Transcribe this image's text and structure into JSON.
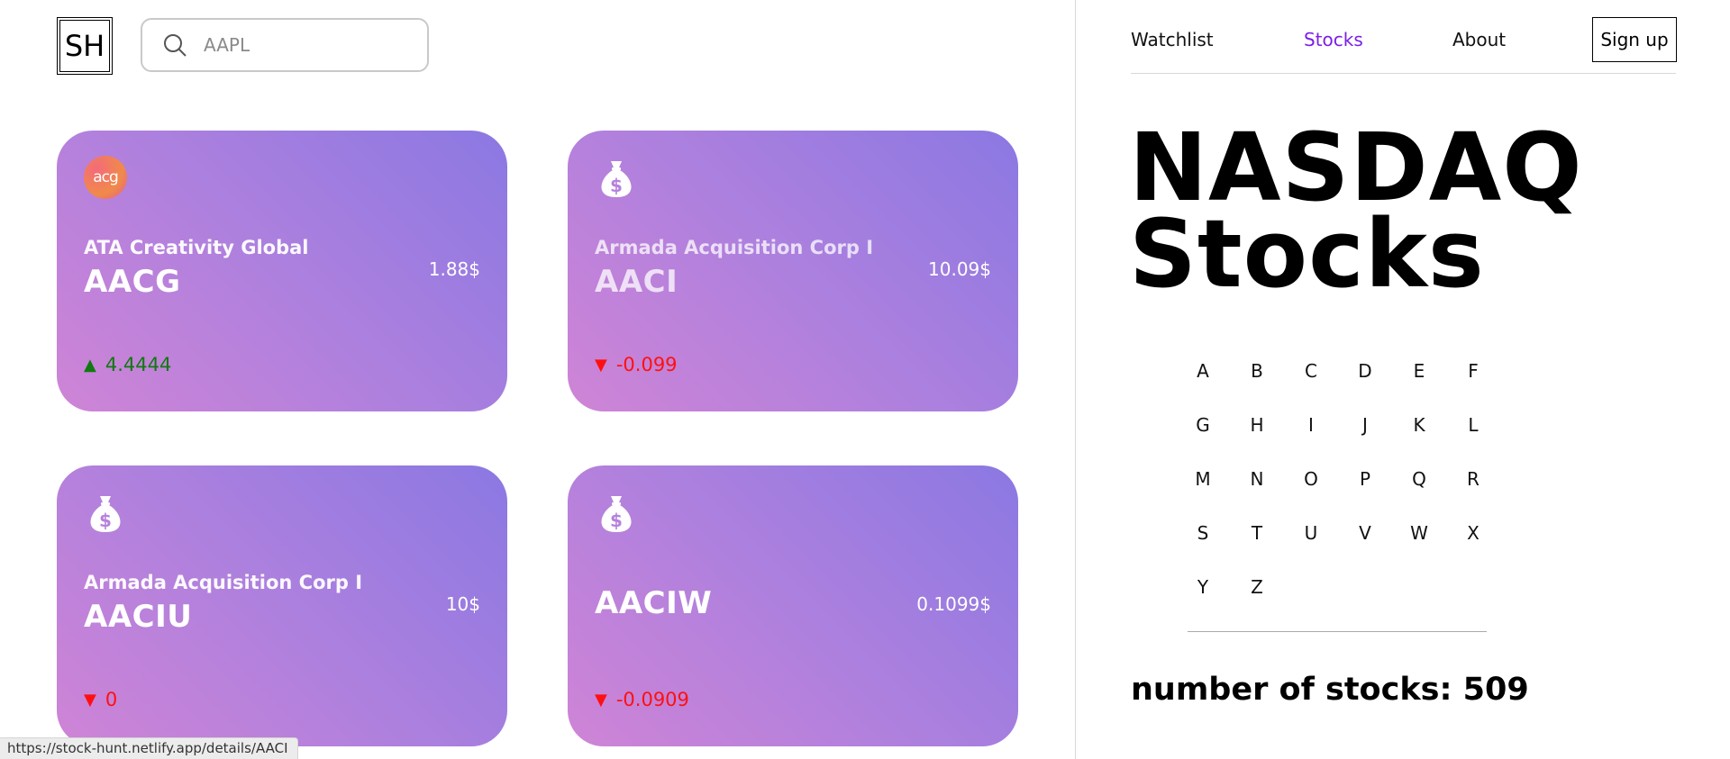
{
  "logo": {
    "text": "SH"
  },
  "search": {
    "placeholder": "AAPL",
    "value": ""
  },
  "cards": [
    {
      "name": "ATA Creativity Global",
      "symbol": "AACG",
      "price": "1.88$",
      "change_arrow": "▲",
      "change": "4.4444",
      "direction": "up",
      "icon": "acg-logo",
      "icon_text": "acg"
    },
    {
      "name": "Armada Acquisition Corp I",
      "symbol": "AACI",
      "price": "10.09$",
      "change_arrow": "▼",
      "change": "-0.099",
      "direction": "down",
      "icon": "money-bag-icon"
    },
    {
      "name": "Armada Acquisition Corp I",
      "symbol": "AACIU",
      "price": "10$",
      "change_arrow": "▼",
      "change": "0",
      "direction": "down",
      "icon": "money-bag-icon"
    },
    {
      "name": "",
      "symbol": "AACIW",
      "price": "0.1099$",
      "change_arrow": "▼",
      "change": "-0.0909",
      "direction": "down",
      "icon": "money-bag-icon"
    }
  ],
  "status_bar": {
    "url": "https://stock-hunt.netlify.app/details/AACI"
  },
  "nav": {
    "items": [
      {
        "label": "Watchlist",
        "active": false
      },
      {
        "label": "Stocks",
        "active": true
      },
      {
        "label": "About",
        "active": false
      }
    ],
    "signup_label": "Sign up"
  },
  "title": {
    "line1": "NASDAQ",
    "line2": "Stocks"
  },
  "alphabet": [
    "A",
    "B",
    "C",
    "D",
    "E",
    "F",
    "G",
    "H",
    "I",
    "J",
    "K",
    "L",
    "M",
    "N",
    "O",
    "P",
    "Q",
    "R",
    "S",
    "T",
    "U",
    "V",
    "W",
    "X",
    "Y",
    "Z"
  ],
  "stock_count": {
    "label": "number of stocks:",
    "value": "509"
  },
  "colors": {
    "accent": "#7b1fe6",
    "card_gradient_start": "#cf84d6",
    "card_gradient_end": "#8b78e2",
    "up": "#0f7a0f",
    "down": "#ff1010"
  }
}
